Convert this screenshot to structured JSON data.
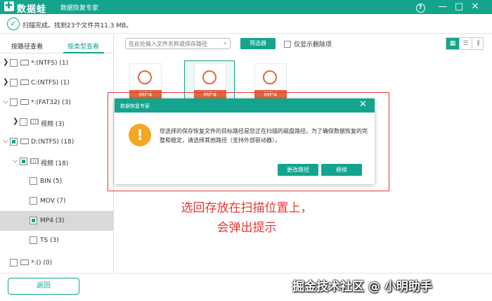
{
  "app": {
    "logo_text": "数据蛙",
    "subtitle": "数据恢复专家"
  },
  "status": {
    "text": "扫描完成。找到23个文件共11.3 MB。"
  },
  "tabs": {
    "by_path": "按路径查看",
    "by_type": "按类型查看"
  },
  "tree": [
    {
      "label": "*:(NTFS) (1)"
    },
    {
      "label": "C:(NTFS) (1)"
    },
    {
      "label": "*:(FAT32) (3)"
    },
    {
      "label": "视频 (3)"
    },
    {
      "label": "D:(NTFS) (18)"
    },
    {
      "label": "视频 (18)"
    },
    {
      "label": "BIN (5)"
    },
    {
      "label": "MOV (7)"
    },
    {
      "label": "MP4 (3)"
    },
    {
      "label": "TS (3)"
    },
    {
      "label": "*:() (0)"
    }
  ],
  "toolbar": {
    "search_placeholder": "在此处输入文件名称或保存路径",
    "filter_label": "筛选器",
    "only_deleted_label": "仅显示删除项"
  },
  "files": [
    {
      "label": "MP4"
    },
    {
      "label": "MP4"
    },
    {
      "label": "MP4"
    }
  ],
  "dialog": {
    "title": "数据恢复专家",
    "message": "您选择的保存恢复文件的目标路径是您正在扫描的磁盘路径。为了确保数据恢复的完整和稳定，请选择其他路径（支持外部驱动器）。",
    "change_path_label": "更改路径",
    "continue_label": "继续"
  },
  "annotation": {
    "line1": "选回存放在扫描位置上，",
    "line2": "会弹出提示"
  },
  "bottom": {
    "back_label": "返回",
    "watermark": "掘金技术社区 @ 小明助手"
  },
  "colors": {
    "brand": "#14a48d",
    "warning": "#f5a623",
    "annotation": "#e53935",
    "file_icon": "#e06a3c"
  }
}
